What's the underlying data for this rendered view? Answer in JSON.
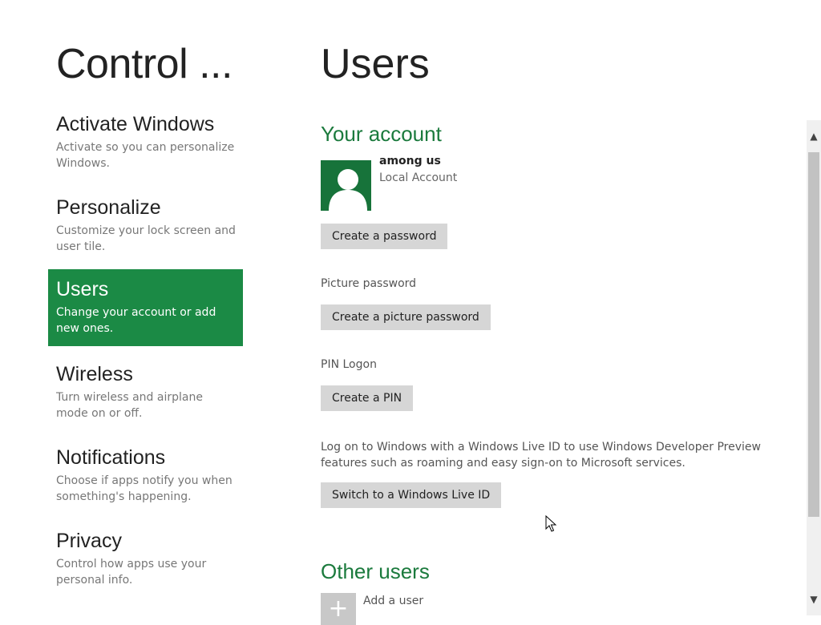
{
  "nav": {
    "title": "Control ...",
    "items": [
      {
        "title": "Activate Windows",
        "desc": "Activate so you can personalize Windows."
      },
      {
        "title": "Personalize",
        "desc": "Customize your lock screen and user tile."
      },
      {
        "title": "Users",
        "desc": "Change your account or add new ones."
      },
      {
        "title": "Wireless",
        "desc": "Turn wireless and airplane mode on or off."
      },
      {
        "title": "Notifications",
        "desc": "Choose if apps notify you when something's happening."
      },
      {
        "title": "Privacy",
        "desc": "Control how apps use your personal info."
      }
    ],
    "selected": "Users"
  },
  "main": {
    "title": "Users",
    "your_account": {
      "heading": "Your account",
      "name": "among us",
      "type": "Local Account",
      "create_password_button": "Create a password"
    },
    "picture_password": {
      "label": "Picture password",
      "button": "Create a picture password"
    },
    "pin": {
      "label": "PIN Logon",
      "button": "Create a PIN"
    },
    "live_id": {
      "text": "Log on to Windows with a Windows Live ID to use Windows Developer Preview features such as roaming and easy sign-on to Microsoft services.",
      "button": "Switch to a Windows Live ID"
    },
    "other_users": {
      "heading": "Other users",
      "add_user": "Add a user"
    }
  },
  "icons": {
    "avatar": "user-silhouette-icon",
    "add_user": "plus-icon",
    "scroll_up": "chevron-up-icon",
    "scroll_down": "chevron-down-icon",
    "cursor": "mouse-pointer-icon"
  },
  "colors": {
    "accent": "#1b8a45",
    "heading_green": "#1b7a3d",
    "avatar_bg": "#17733a",
    "button_bg": "#d6d6d6"
  }
}
